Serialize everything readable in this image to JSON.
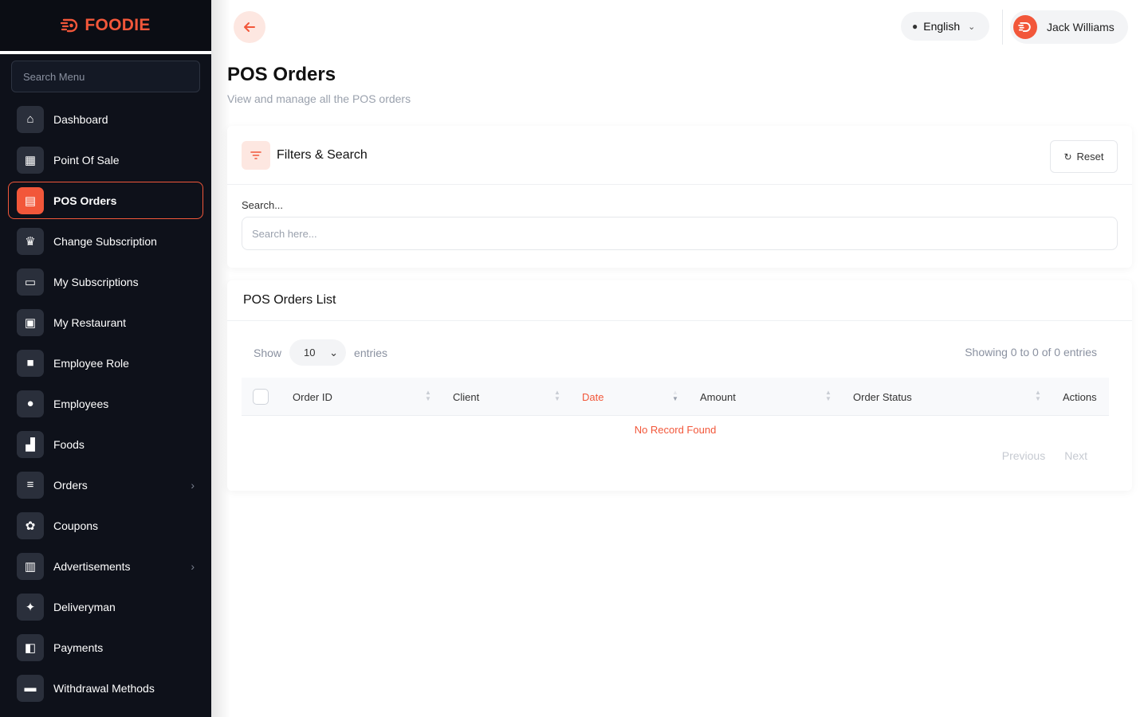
{
  "brand": {
    "name": "FOODIE",
    "color": "#f2573a"
  },
  "sidebar": {
    "search_placeholder": "Search Menu",
    "items": [
      {
        "label": "Dashboard",
        "icon": "home-icon"
      },
      {
        "label": "Point Of Sale",
        "icon": "calculator-icon"
      },
      {
        "label": "POS Orders",
        "icon": "receipt-icon",
        "active": true
      },
      {
        "label": "Change Subscription",
        "icon": "crown-icon"
      },
      {
        "label": "My Subscriptions",
        "icon": "monitor-icon"
      },
      {
        "label": "My Restaurant",
        "icon": "store-icon"
      },
      {
        "label": "Employee Role",
        "icon": "lock-icon"
      },
      {
        "label": "Employees",
        "icon": "user-icon"
      },
      {
        "label": "Foods",
        "icon": "food-icon"
      },
      {
        "label": "Orders",
        "icon": "list-icon",
        "has_submenu": true
      },
      {
        "label": "Coupons",
        "icon": "badge-icon"
      },
      {
        "label": "Advertisements",
        "icon": "ad-icon",
        "has_submenu": true
      },
      {
        "label": "Deliveryman",
        "icon": "runner-icon"
      },
      {
        "label": "Payments",
        "icon": "wallet-icon"
      },
      {
        "label": "Withdrawal Methods",
        "icon": "card-icon"
      }
    ]
  },
  "header": {
    "language": "English",
    "user_name": "Jack Williams"
  },
  "page": {
    "title": "POS Orders",
    "subtitle": "View and manage all the POS orders"
  },
  "filters": {
    "title": "Filters & Search",
    "reset_label": "Reset",
    "search_label": "Search...",
    "search_placeholder": "Search here..."
  },
  "list": {
    "title": "POS Orders List",
    "show_label": "Show",
    "entries_value": "10",
    "entries_label": "entries",
    "showing_text": "Showing 0 to 0 of 0 entries",
    "columns": [
      "Order ID",
      "Client",
      "Date",
      "Amount",
      "Order Status",
      "Actions"
    ],
    "sorted_column": "Date",
    "empty_text": "No Record Found",
    "prev_label": "Previous",
    "next_label": "Next"
  }
}
